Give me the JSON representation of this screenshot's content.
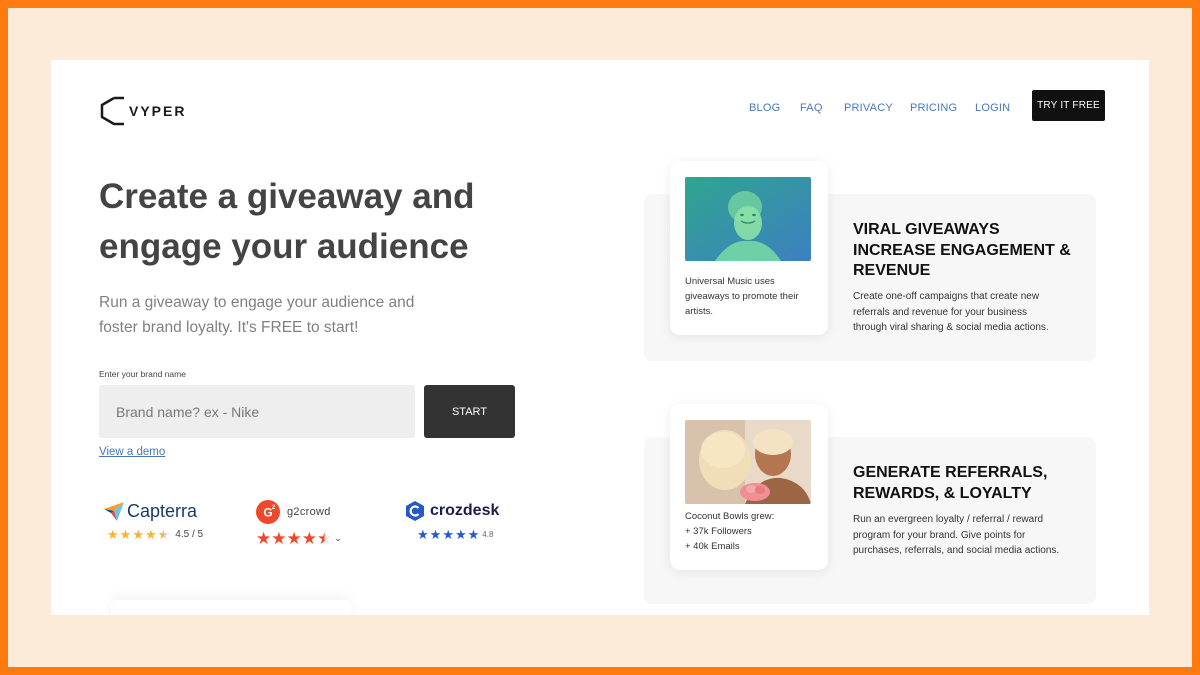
{
  "brand": {
    "name": "VYPER",
    "logo_icon": "hexagon-chevron-icon"
  },
  "nav": {
    "links": [
      "BLOG",
      "FAQ",
      "PRIVACY",
      "PRICING",
      "LOGIN"
    ],
    "cta": "TRY IT FREE"
  },
  "hero": {
    "title_line1": "Create a giveaway and",
    "title_line2": "engage your audience",
    "subtitle_line1": "Run a giveaway to engage your audience and",
    "subtitle_line2": "foster brand loyalty. It's FREE to start!"
  },
  "signup": {
    "label": "Enter your brand name",
    "placeholder": "Brand name? ex - Nike",
    "button": "START",
    "demo_link": "View a demo"
  },
  "reviews": {
    "capterra": {
      "name": "Capterra",
      "rating": "4.5 / 5",
      "stars": 4.5,
      "color": "#F9B233"
    },
    "g2": {
      "name": "g2crowd",
      "stars": 4.5,
      "caret": "⌄",
      "color": "#EF492D"
    },
    "crozdesk": {
      "name": "crozdesk",
      "rating": "4.8",
      "stars": 5,
      "color": "#2359C8"
    }
  },
  "features": [
    {
      "caption": [
        "Universal Music uses",
        "giveaways to promote their",
        "artists."
      ],
      "title": [
        "VIRAL GIVEAWAYS",
        "INCREASE ENGAGEMENT &",
        "REVENUE"
      ],
      "description": [
        "Create one-off campaigns that create new",
        "referrals and revenue for your business",
        "through viral sharing & social media actions."
      ]
    },
    {
      "caption": [
        "Coconut Bowls grew:",
        "+ 37k Followers",
        "+ 40k Emails"
      ],
      "title": [
        "GENERATE REFERRALS,",
        "REWARDS, & LOYALTY"
      ],
      "description": [
        "Run an evergreen loyalty / referral / reward",
        "program for your brand. Give points for",
        "purchases, referrals, and social media actions."
      ]
    }
  ],
  "colors": {
    "frame": "#FF7B0F",
    "backdrop": "#FDEBD9",
    "link": "#4A78B5",
    "button_dark": "#333333"
  }
}
